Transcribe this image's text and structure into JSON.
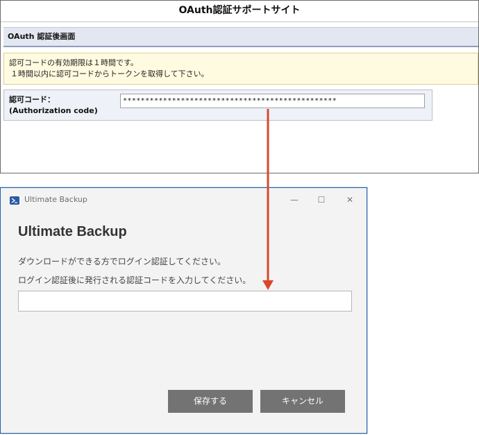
{
  "oauth_page": {
    "title": "OAuth認証サポートサイト",
    "subheader": "OAuth 認証後画面",
    "notice_line1": "認可コードの有効期限は１時間です。",
    "notice_line2": "１時間以内に認可コードからトークンを取得して下さい。",
    "code_label_line1": "認可コード：",
    "code_label_line2": "(Authorization code)",
    "code_value": "************************************************"
  },
  "app": {
    "window_title": "Ultimate Backup",
    "heading": "Ultimate Backup",
    "instruction_1": "ダウンロードができる方でログイン認証してください。",
    "instruction_2": "ログイン認証後に発行される認証コードを入力してください。",
    "code_input_value": "",
    "save_label": "保存する",
    "cancel_label": "キャンセル",
    "minimize_glyph": "—",
    "maximize_glyph": "☐",
    "close_glyph": "✕"
  },
  "colors": {
    "arrow": "#d9472b",
    "button_bg": "#737373",
    "window_border": "#1f5fae"
  },
  "icons": {
    "app_icon": "powershell-icon",
    "arrow": "red-arrow-down"
  }
}
